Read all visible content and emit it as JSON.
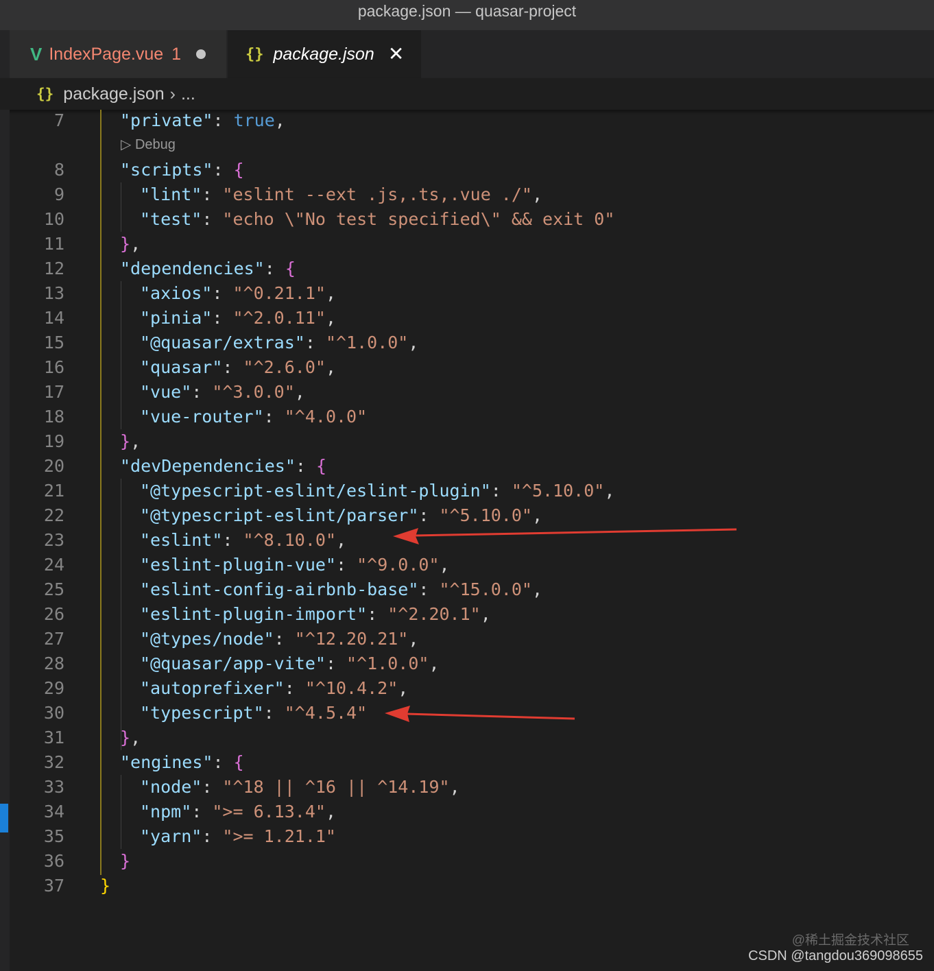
{
  "window": {
    "title": "package.json — quasar-project"
  },
  "tabs": [
    {
      "label": "IndexPage.vue",
      "problems": "1",
      "icon": "vue-icon",
      "state": "modified"
    },
    {
      "label": "package.json",
      "icon": "json-braces-icon",
      "state": "active"
    }
  ],
  "breadcrumb": {
    "file": "package.json",
    "more": "..."
  },
  "codelens": {
    "label": "Debug"
  },
  "code": {
    "lines": [
      {
        "n": "7",
        "tokens": [
          [
            "k",
            "\"private\""
          ],
          [
            "p",
            ": "
          ],
          [
            "b",
            "true"
          ],
          [
            "p",
            ","
          ]
        ]
      },
      {
        "n": "8",
        "tokens": [
          [
            "k",
            "\"scripts\""
          ],
          [
            "p",
            ": "
          ],
          [
            "br2",
            "{"
          ]
        ]
      },
      {
        "n": "9",
        "tokens": [
          [
            "k",
            "\"lint\""
          ],
          [
            "p",
            ": "
          ],
          [
            "s",
            "\"eslint --ext .js,.ts,.vue ./\""
          ],
          [
            "p",
            ","
          ]
        ]
      },
      {
        "n": "10",
        "tokens": [
          [
            "k",
            "\"test\""
          ],
          [
            "p",
            ": "
          ],
          [
            "s",
            "\"echo \\\"No test specified\\\" && exit 0\""
          ]
        ]
      },
      {
        "n": "11",
        "tokens": [
          [
            "br2",
            "}"
          ],
          [
            "p",
            ","
          ]
        ]
      },
      {
        "n": "12",
        "tokens": [
          [
            "k",
            "\"dependencies\""
          ],
          [
            "p",
            ": "
          ],
          [
            "br2",
            "{"
          ]
        ]
      },
      {
        "n": "13",
        "tokens": [
          [
            "k",
            "\"axios\""
          ],
          [
            "p",
            ": "
          ],
          [
            "s",
            "\"^0.21.1\""
          ],
          [
            "p",
            ","
          ]
        ]
      },
      {
        "n": "14",
        "tokens": [
          [
            "k",
            "\"pinia\""
          ],
          [
            "p",
            ": "
          ],
          [
            "s",
            "\"^2.0.11\""
          ],
          [
            "p",
            ","
          ]
        ]
      },
      {
        "n": "15",
        "tokens": [
          [
            "k",
            "\"@quasar/extras\""
          ],
          [
            "p",
            ": "
          ],
          [
            "s",
            "\"^1.0.0\""
          ],
          [
            "p",
            ","
          ]
        ]
      },
      {
        "n": "16",
        "tokens": [
          [
            "k",
            "\"quasar\""
          ],
          [
            "p",
            ": "
          ],
          [
            "s",
            "\"^2.6.0\""
          ],
          [
            "p",
            ","
          ]
        ]
      },
      {
        "n": "17",
        "tokens": [
          [
            "k",
            "\"vue\""
          ],
          [
            "p",
            ": "
          ],
          [
            "s",
            "\"^3.0.0\""
          ],
          [
            "p",
            ","
          ]
        ]
      },
      {
        "n": "18",
        "tokens": [
          [
            "k",
            "\"vue-router\""
          ],
          [
            "p",
            ": "
          ],
          [
            "s",
            "\"^4.0.0\""
          ]
        ]
      },
      {
        "n": "19",
        "tokens": [
          [
            "br2",
            "}"
          ],
          [
            "p",
            ","
          ]
        ]
      },
      {
        "n": "20",
        "tokens": [
          [
            "k",
            "\"devDependencies\""
          ],
          [
            "p",
            ": "
          ],
          [
            "br2",
            "{"
          ]
        ]
      },
      {
        "n": "21",
        "tokens": [
          [
            "k",
            "\"@typescript-eslint/eslint-plugin\""
          ],
          [
            "p",
            ": "
          ],
          [
            "s",
            "\"^5.10.0\""
          ],
          [
            "p",
            ","
          ]
        ]
      },
      {
        "n": "22",
        "tokens": [
          [
            "k",
            "\"@typescript-eslint/parser\""
          ],
          [
            "p",
            ": "
          ],
          [
            "s",
            "\"^5.10.0\""
          ],
          [
            "p",
            ","
          ]
        ]
      },
      {
        "n": "23",
        "tokens": [
          [
            "k",
            "\"eslint\""
          ],
          [
            "p",
            ": "
          ],
          [
            "s",
            "\"^8.10.0\""
          ],
          [
            "p",
            ","
          ]
        ]
      },
      {
        "n": "24",
        "tokens": [
          [
            "k",
            "\"eslint-plugin-vue\""
          ],
          [
            "p",
            ": "
          ],
          [
            "s",
            "\"^9.0.0\""
          ],
          [
            "p",
            ","
          ]
        ]
      },
      {
        "n": "25",
        "tokens": [
          [
            "k",
            "\"eslint-config-airbnb-base\""
          ],
          [
            "p",
            ": "
          ],
          [
            "s",
            "\"^15.0.0\""
          ],
          [
            "p",
            ","
          ]
        ]
      },
      {
        "n": "26",
        "tokens": [
          [
            "k",
            "\"eslint-plugin-import\""
          ],
          [
            "p",
            ": "
          ],
          [
            "s",
            "\"^2.20.1\""
          ],
          [
            "p",
            ","
          ]
        ]
      },
      {
        "n": "27",
        "tokens": [
          [
            "k",
            "\"@types/node\""
          ],
          [
            "p",
            ": "
          ],
          [
            "s",
            "\"^12.20.21\""
          ],
          [
            "p",
            ","
          ]
        ]
      },
      {
        "n": "28",
        "tokens": [
          [
            "k",
            "\"@quasar/app-vite\""
          ],
          [
            "p",
            ": "
          ],
          [
            "s",
            "\"^1.0.0\""
          ],
          [
            "p",
            ","
          ]
        ]
      },
      {
        "n": "29",
        "tokens": [
          [
            "k",
            "\"autoprefixer\""
          ],
          [
            "p",
            ": "
          ],
          [
            "s",
            "\"^10.4.2\""
          ],
          [
            "p",
            ","
          ]
        ]
      },
      {
        "n": "30",
        "tokens": [
          [
            "k",
            "\"typescript\""
          ],
          [
            "p",
            ": "
          ],
          [
            "s",
            "\"^4.5.4\""
          ]
        ]
      },
      {
        "n": "31",
        "tokens": [
          [
            "br2",
            "}"
          ],
          [
            "p",
            ","
          ]
        ]
      },
      {
        "n": "32",
        "tokens": [
          [
            "k",
            "\"engines\""
          ],
          [
            "p",
            ": "
          ],
          [
            "br2",
            "{"
          ]
        ]
      },
      {
        "n": "33",
        "tokens": [
          [
            "k",
            "\"node\""
          ],
          [
            "p",
            ": "
          ],
          [
            "s",
            "\"^18 || ^16 || ^14.19\""
          ],
          [
            "p",
            ","
          ]
        ]
      },
      {
        "n": "34",
        "tokens": [
          [
            "k",
            "\"npm\""
          ],
          [
            "p",
            ": "
          ],
          [
            "s",
            "\">= 6.13.4\""
          ],
          [
            "p",
            ","
          ]
        ]
      },
      {
        "n": "35",
        "tokens": [
          [
            "k",
            "\"yarn\""
          ],
          [
            "p",
            ": "
          ],
          [
            "s",
            "\">= 1.21.1\""
          ]
        ]
      },
      {
        "n": "36",
        "tokens": [
          [
            "br2",
            "}"
          ]
        ]
      },
      {
        "n": "37",
        "tokens": [
          [
            "br1",
            "}"
          ]
        ]
      }
    ]
  },
  "colors": {
    "key": "#9cdcfe",
    "string": "#ce9178",
    "boolean": "#569cd6",
    "bracket_level1": "#ffd700",
    "bracket_level2": "#da70d6",
    "annotation_arrow": "#e03c31"
  },
  "watermark": {
    "line1": "@稀土掘金技术社区",
    "line2": "CSDN @tangdou369098655"
  }
}
